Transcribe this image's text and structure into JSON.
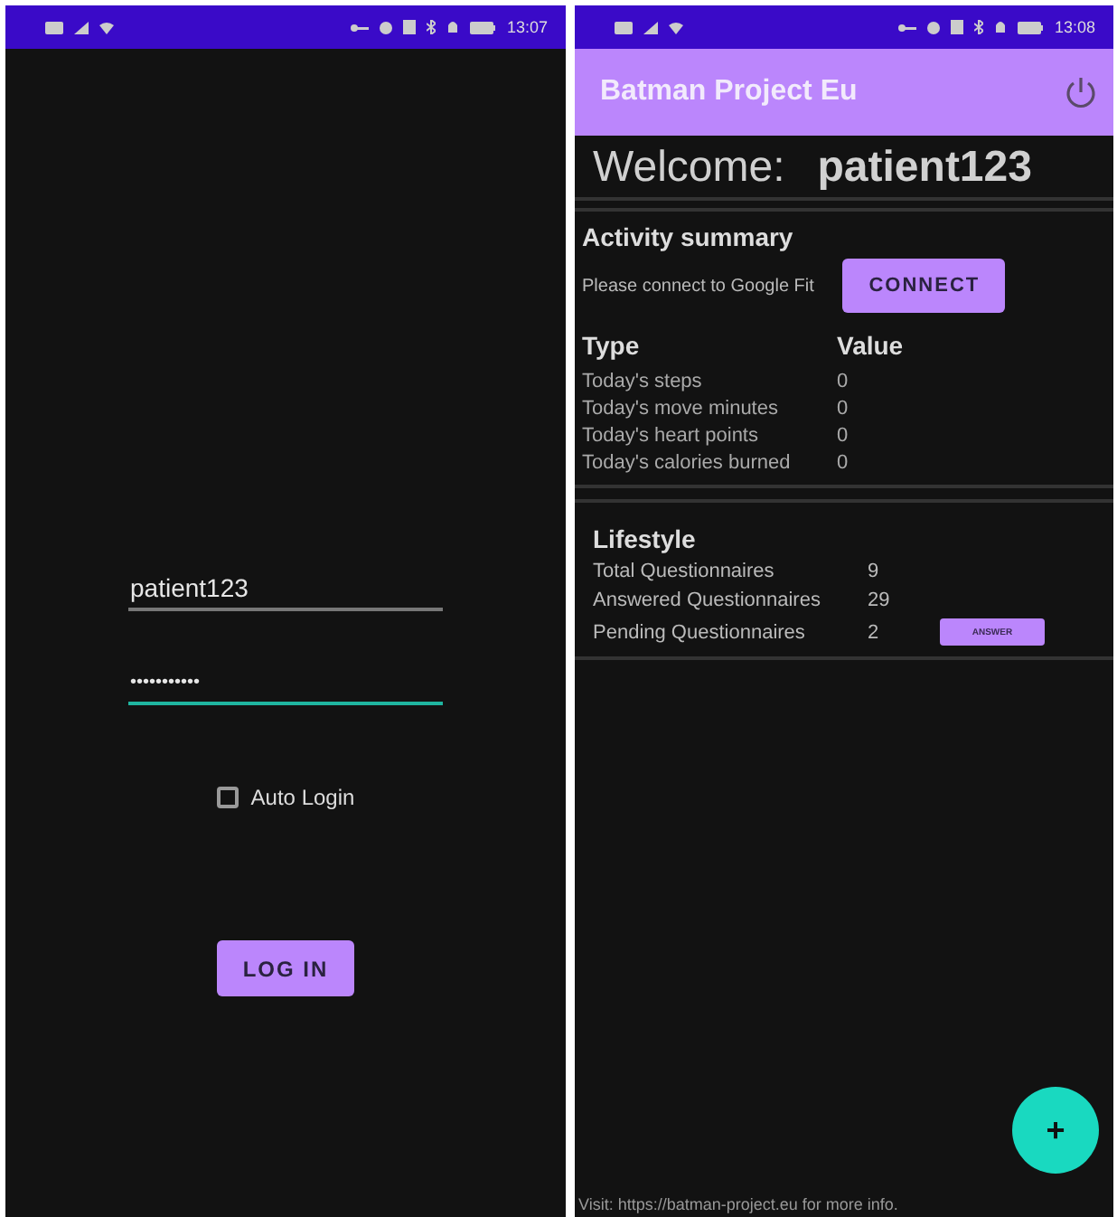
{
  "login_screen": {
    "status_bar": {
      "time": "13:07"
    },
    "username": {
      "value": "patient123",
      "focused": false
    },
    "password": {
      "value": "•••••••••••",
      "focused": true
    },
    "auto_login": {
      "label": "Auto Login",
      "checked": false
    },
    "login_button": "LOG IN"
  },
  "home_screen": {
    "status_bar": {
      "time": "13:08"
    },
    "app_bar": {
      "title": "Batman Project Eu"
    },
    "welcome": {
      "label": "Welcome:",
      "user": "patient123"
    },
    "activity": {
      "title": "Activity summary",
      "prompt": "Please connect to Google Fit",
      "button": "CONNECT",
      "columns": [
        "Type",
        "Value"
      ],
      "rows": [
        {
          "type": "Today's steps",
          "value": "0"
        },
        {
          "type": "Today's move minutes",
          "value": "0"
        },
        {
          "type": "Today's heart points",
          "value": "0"
        },
        {
          "type": "Today's calories burned",
          "value": "0"
        }
      ]
    },
    "lifestyle": {
      "title": "Lifestyle",
      "rows": [
        {
          "label": "Total Questionnaires",
          "value": "9"
        },
        {
          "label": "Answered Questionnaires",
          "value": "29"
        },
        {
          "label": "Pending Questionnaires",
          "value": "2",
          "action": "ANSWER"
        }
      ]
    },
    "fab": "+",
    "footer": "Visit: https://batman-project.eu for more info."
  }
}
